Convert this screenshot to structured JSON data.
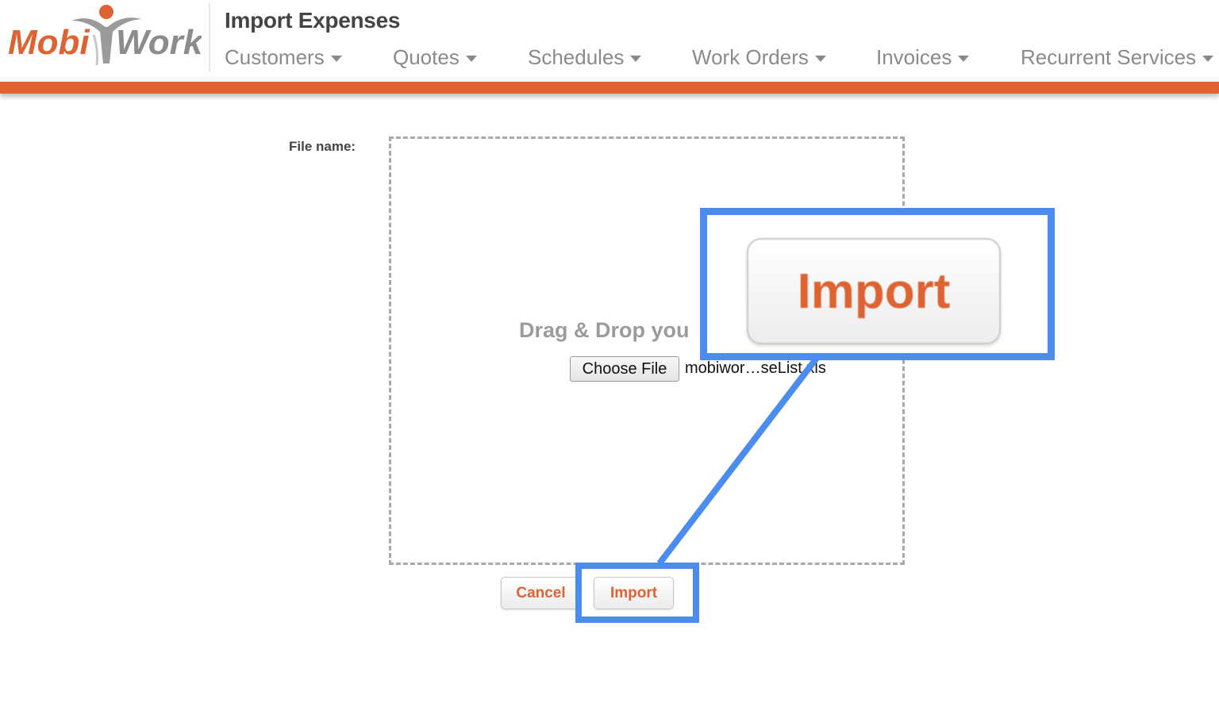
{
  "header": {
    "page_title": "Import Expenses",
    "logo": {
      "text_left": "Mobi",
      "text_right": "Work",
      "brand_color": "#de6332",
      "secondary_color": "#8c8c8c"
    },
    "nav": [
      {
        "label": "Customers"
      },
      {
        "label": "Quotes"
      },
      {
        "label": "Schedules"
      },
      {
        "label": "Work Orders"
      },
      {
        "label": "Invoices"
      },
      {
        "label": "Recurrent Services"
      }
    ]
  },
  "colors": {
    "accent": "#de6332",
    "highlight": "#4a8cef"
  },
  "form": {
    "file_name_label": "File name:",
    "drop_text": "Drag & Drop you",
    "choose_file_label": "Choose File",
    "chosen_file_name": "mobiwor…seList.xls",
    "cancel_label": "Cancel",
    "import_label": "Import"
  },
  "callout": {
    "zoomed_label": "Import"
  }
}
